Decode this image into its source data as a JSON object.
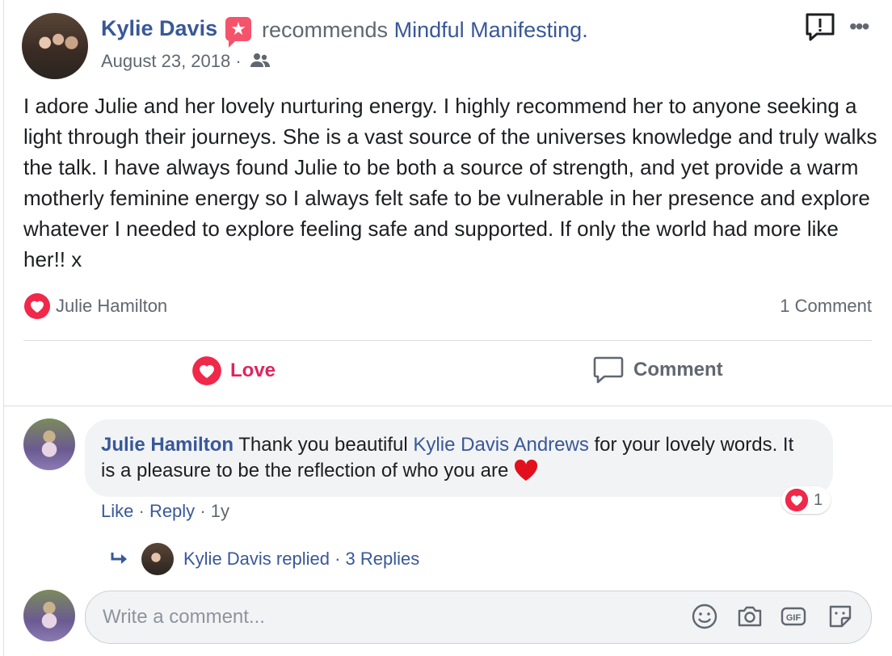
{
  "post": {
    "author": "Kylie Davis",
    "recommends_text": "recommends",
    "page_name": "Mindful Manifesting.",
    "date": "August 23, 2018 ·",
    "text": "I adore Julie and her lovely nurturing energy. I highly recommend her to anyone seeking a light through their journeys. She is a vast source of the universes knowledge and truly walks the talk. I have always found Julie to be both a source of strength, and yet provide a warm motherly feminine energy so I always felt safe to be vulnerable in her presence and explore whatever I needed to explore feeling safe and supported. If only the world had more like her!! x",
    "reaction_names": "Julie Hamilton",
    "comment_count": "1 Comment"
  },
  "actions": {
    "love_label": "Love",
    "comment_label": "Comment"
  },
  "comment": {
    "author": "Julie Hamilton",
    "text_before": "Thank you beautiful",
    "mention": "Kylie Davis Andrews",
    "text_after": "for your lovely words. It is a pleasure to be the reflection of who you are",
    "like_label": "Like",
    "separator": "·",
    "reply_label": "Reply",
    "time": "1y",
    "reaction_count": "1"
  },
  "replies": {
    "label": "Kylie Davis replied",
    "count": "· 3 Replies"
  },
  "composer": {
    "placeholder": "Write a comment..."
  },
  "icons": [
    "report-icon",
    "more-icon",
    "friends-icon",
    "love-icon",
    "comment-icon",
    "reply-arrow-icon",
    "emoji-icon",
    "camera-icon",
    "gif-icon",
    "sticker-icon"
  ],
  "colors": {
    "link": "#385898",
    "love": "#e0245e",
    "badge": "#f5536b",
    "muted": "#606770"
  }
}
